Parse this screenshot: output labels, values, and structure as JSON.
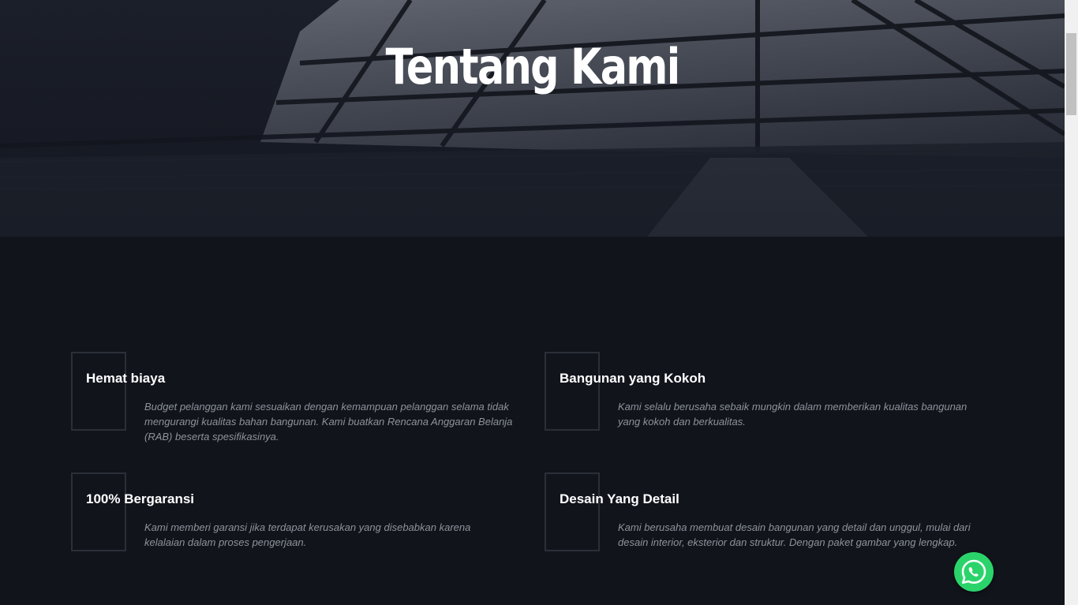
{
  "hero": {
    "title": "Tentang Kami"
  },
  "features": [
    {
      "title": "Hemat biaya",
      "description": "Budget pelanggan kami sesuaikan dengan kemampuan pelanggan selama tidak mengurangi kualitas bahan bangunan. Kami buatkan Rencana Anggaran Belanja (RAB) beserta spesifikasinya."
    },
    {
      "title": "Bangunan yang Kokoh",
      "description": "Kami selalu berusaha sebaik mungkin dalam memberikan kualitas bangunan yang kokoh dan berkualitas."
    },
    {
      "title": "100% Bergaransi",
      "description": "Kami memberi garansi jika terdapat kerusakan yang disebabkan karena kelalaian dalam proses pengerjaan."
    },
    {
      "title": "Desain Yang Detail",
      "description": "Kami berusaha membuat desain bangunan yang detail dan unggul, mulai dari desain interior, eksterior dan struktur. Dengan paket gambar yang lengkap."
    }
  ],
  "whatsapp": {
    "icon": "whatsapp-icon",
    "color": "#2bd46a"
  },
  "colors": {
    "background": "#11141b",
    "title": "#ffffff",
    "description": "#8e939c",
    "frame": "#2a2f38"
  }
}
